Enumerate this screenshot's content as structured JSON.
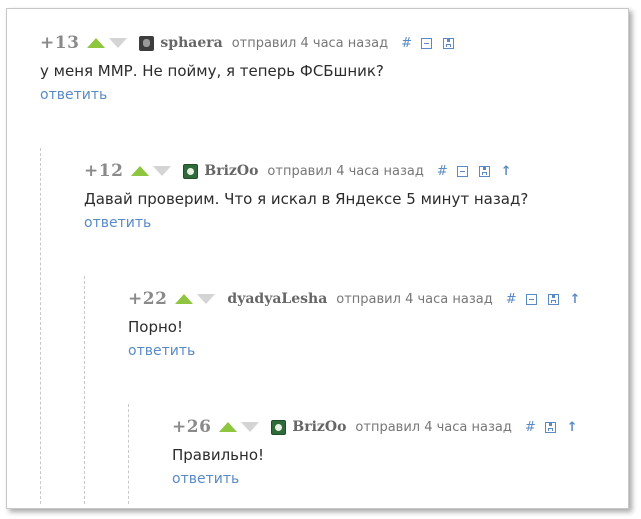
{
  "colors": {
    "accent": "#5a8ac6",
    "vote_up": "#8ec63f",
    "vote_down": "#d4d4d4"
  },
  "comments": [
    {
      "rating": "+13",
      "username": "sphaera",
      "avatar": "dark-avatar",
      "meta": "отправил 4 часа назад",
      "text": "у меня ММР. Не пойму, я теперь ФСБшник?",
      "reply_label": "ответить",
      "actions": [
        "link",
        "collapse",
        "save"
      ]
    },
    {
      "rating": "+12",
      "username": "BrizOo",
      "avatar": "green-avatar",
      "meta": "отправил 4 часа назад",
      "text": "Давай проверим. Что я искал в Яндексе 5 минут назад?",
      "reply_label": "ответить",
      "actions": [
        "link",
        "collapse",
        "save",
        "parent"
      ]
    },
    {
      "rating": "+22",
      "username": "dyadyaLesha",
      "avatar": "none",
      "meta": "отправил 4 часа назад",
      "text": "Порно!",
      "reply_label": "ответить",
      "actions": [
        "link",
        "collapse",
        "save",
        "parent"
      ]
    },
    {
      "rating": "+26",
      "username": "BrizOo",
      "avatar": "green-avatar",
      "meta": "отправил 4 часа назад",
      "text": "Правильно!",
      "reply_label": "ответить",
      "actions": [
        "link",
        "save",
        "parent"
      ]
    }
  ],
  "icons": {
    "link": "#",
    "parent": "↑"
  }
}
